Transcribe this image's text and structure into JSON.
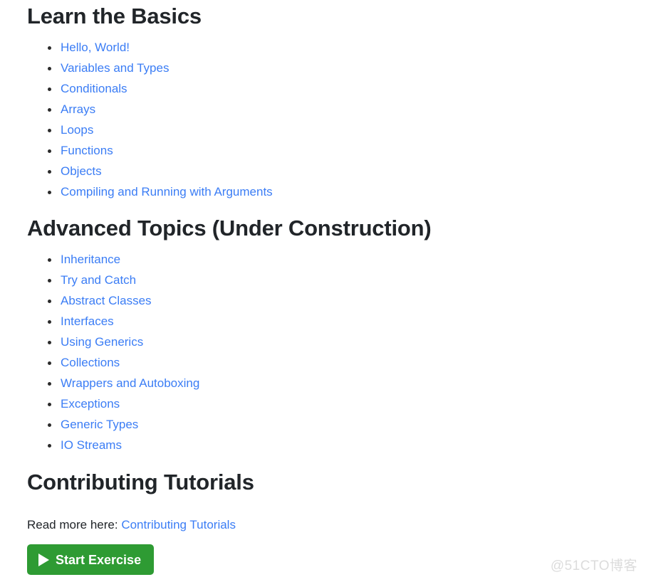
{
  "page": {
    "background_color": "#ffffff",
    "text_color": "#212529",
    "link_color": "#3b7df5"
  },
  "sections": {
    "basics": {
      "heading": "Learn the Basics",
      "items": [
        "Hello, World!",
        "Variables and Types",
        "Conditionals",
        "Arrays",
        "Loops",
        "Functions",
        "Objects",
        "Compiling and Running with Arguments"
      ]
    },
    "advanced": {
      "heading": "Advanced Topics (Under Construction)",
      "items": [
        "Inheritance",
        "Try and Catch",
        "Abstract Classes",
        "Interfaces",
        "Using Generics",
        "Collections",
        "Wrappers and Autoboxing",
        "Exceptions",
        "Generic Types",
        "IO Streams"
      ]
    },
    "contributing": {
      "heading": "Contributing Tutorials",
      "read_more_prefix": "Read more here:",
      "read_more_link": "Contributing Tutorials"
    }
  },
  "start_button": {
    "label": "Start Exercise",
    "icon": "play-icon",
    "background_color": "#2e9b33",
    "text_color": "#ffffff"
  },
  "watermark": {
    "text": "@51CTO博客",
    "color": "#dcdcdc"
  }
}
